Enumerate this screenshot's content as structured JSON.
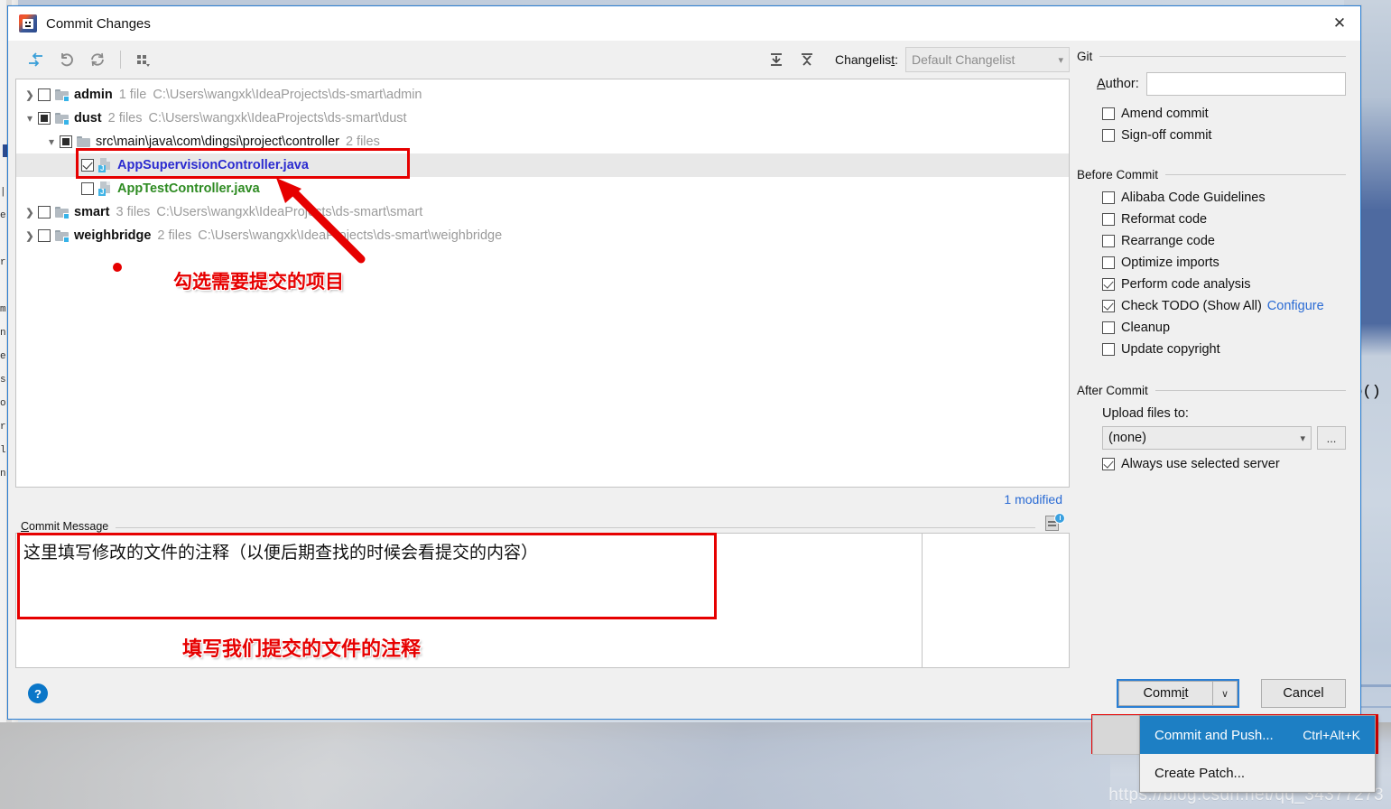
{
  "window": {
    "title": "Commit Changes",
    "app_icon": "intellij-idea-icon",
    "close_label": "✕"
  },
  "toolbar": {
    "buttons": [
      {
        "name": "show-diff-icon",
        "tooltip": "Show Diff"
      },
      {
        "name": "revert-icon",
        "tooltip": "Revert"
      },
      {
        "name": "refresh-icon",
        "tooltip": "Refresh"
      },
      {
        "name": "group-by-icon",
        "tooltip": "Group By"
      },
      {
        "name": "expand-all-icon",
        "tooltip": "Expand All"
      },
      {
        "name": "collapse-all-icon",
        "tooltip": "Collapse All"
      }
    ],
    "changelist_label": "Changelist:",
    "changelist_value": "Default Changelist"
  },
  "tree": {
    "rows": [
      {
        "indent": 0,
        "chevron": "closed",
        "check": "unchecked",
        "icon": "folder-module-icon",
        "name": "admin",
        "meta": "1 file",
        "path": "C:\\Users\\wangxk\\IdeaProjects\\ds-smart\\admin",
        "selected": false,
        "kind": "folder"
      },
      {
        "indent": 0,
        "chevron": "open",
        "check": "partial",
        "icon": "folder-module-icon",
        "name": "dust",
        "meta": "2 files",
        "path": "C:\\Users\\wangxk\\IdeaProjects\\ds-smart\\dust",
        "selected": false,
        "kind": "folder"
      },
      {
        "indent": 1,
        "chevron": "open",
        "check": "partial",
        "icon": "folder-icon",
        "name": "src\\main\\java\\com\\dingsi\\project\\controller",
        "meta": "2 files",
        "path": "",
        "selected": false,
        "kind": "folder-plain"
      },
      {
        "indent": 2,
        "chevron": "none",
        "check": "checked",
        "icon": "java-file-icon",
        "name": "AppSupervisionController.java",
        "meta": "",
        "path": "",
        "selected": true,
        "kind": "file-modified"
      },
      {
        "indent": 2,
        "chevron": "none",
        "check": "unchecked",
        "icon": "java-file-icon",
        "name": "AppTestController.java",
        "meta": "",
        "path": "",
        "selected": false,
        "kind": "file-new"
      },
      {
        "indent": 0,
        "chevron": "closed",
        "check": "unchecked",
        "icon": "folder-module-icon",
        "name": "smart",
        "meta": "3 files",
        "path": "C:\\Users\\wangxk\\IdeaProjects\\ds-smart\\smart",
        "selected": false,
        "kind": "folder"
      },
      {
        "indent": 0,
        "chevron": "closed",
        "check": "unchecked",
        "icon": "folder-module-icon",
        "name": "weighbridge",
        "meta": "2 files",
        "path": "C:\\Users\\wangxk\\IdeaProjects\\ds-smart\\weighbridge",
        "selected": false,
        "kind": "folder"
      }
    ],
    "status": "1 modified"
  },
  "commit_message": {
    "legend": "Commit Message",
    "value": "这里填写修改的文件的注释（以便后期查找的时候会看提交的内容）",
    "history_icon": "commit-message-history-icon"
  },
  "git_section": {
    "title": "Git",
    "author_label": "Author:",
    "author_value": "",
    "checkboxes": [
      {
        "label": "Amend commit",
        "checked": false,
        "name": "amend-commit-checkbox"
      },
      {
        "label": "Sign-off commit",
        "checked": false,
        "name": "sign-off-commit-checkbox"
      }
    ]
  },
  "before_commit": {
    "title": "Before Commit",
    "checkboxes": [
      {
        "label": "Alibaba Code Guidelines",
        "checked": false,
        "name": "alibaba-code-guidelines-checkbox"
      },
      {
        "label": "Reformat code",
        "checked": false,
        "name": "reformat-code-checkbox"
      },
      {
        "label": "Rearrange code",
        "checked": false,
        "name": "rearrange-code-checkbox"
      },
      {
        "label": "Optimize imports",
        "checked": false,
        "name": "optimize-imports-checkbox"
      },
      {
        "label": "Perform code analysis",
        "checked": true,
        "name": "perform-code-analysis-checkbox"
      },
      {
        "label": "Check TODO (Show All)",
        "checked": true,
        "name": "check-todo-checkbox",
        "link": "Configure"
      },
      {
        "label": "Cleanup",
        "checked": false,
        "name": "cleanup-checkbox"
      },
      {
        "label": "Update copyright",
        "checked": false,
        "name": "update-copyright-checkbox"
      }
    ]
  },
  "after_commit": {
    "title": "After Commit",
    "upload_label": "Upload files to:",
    "upload_value": "(none)",
    "dots_label": "...",
    "always_use_label": "Always use selected server",
    "always_use_checked": true
  },
  "footer": {
    "help_label": "?",
    "commit_label": "Commit",
    "commit_arrow": "∨",
    "cancel_label": "Cancel"
  },
  "popup_menu": {
    "items": [
      {
        "label": "Commit and Push...",
        "shortcut": "Ctrl+Alt+K",
        "highlighted": true
      },
      {
        "label": "Create Patch...",
        "shortcut": "",
        "highlighted": false
      }
    ]
  },
  "annotations": [
    {
      "id": "ann-tree",
      "text": "勾选需要提交的项目"
    },
    {
      "id": "ann-msg",
      "text": "填写我们提交的文件的注释"
    }
  ],
  "background": {
    "watermark": "https://blog.csdn.net/qq_34377273",
    "right_code": "Fo()",
    "left_chars": "|\ne\n\nr\n\nm\nn\ne\ns\no\nr\nl\nn"
  },
  "colors": {
    "accent_blue": "#2a7fd4",
    "link_blue": "#2a6bd4",
    "annotation_red": "#e60000",
    "modified_file": "#2b2bd0",
    "new_file": "#2e8b22",
    "menu_highlight": "#1d7fc4"
  }
}
